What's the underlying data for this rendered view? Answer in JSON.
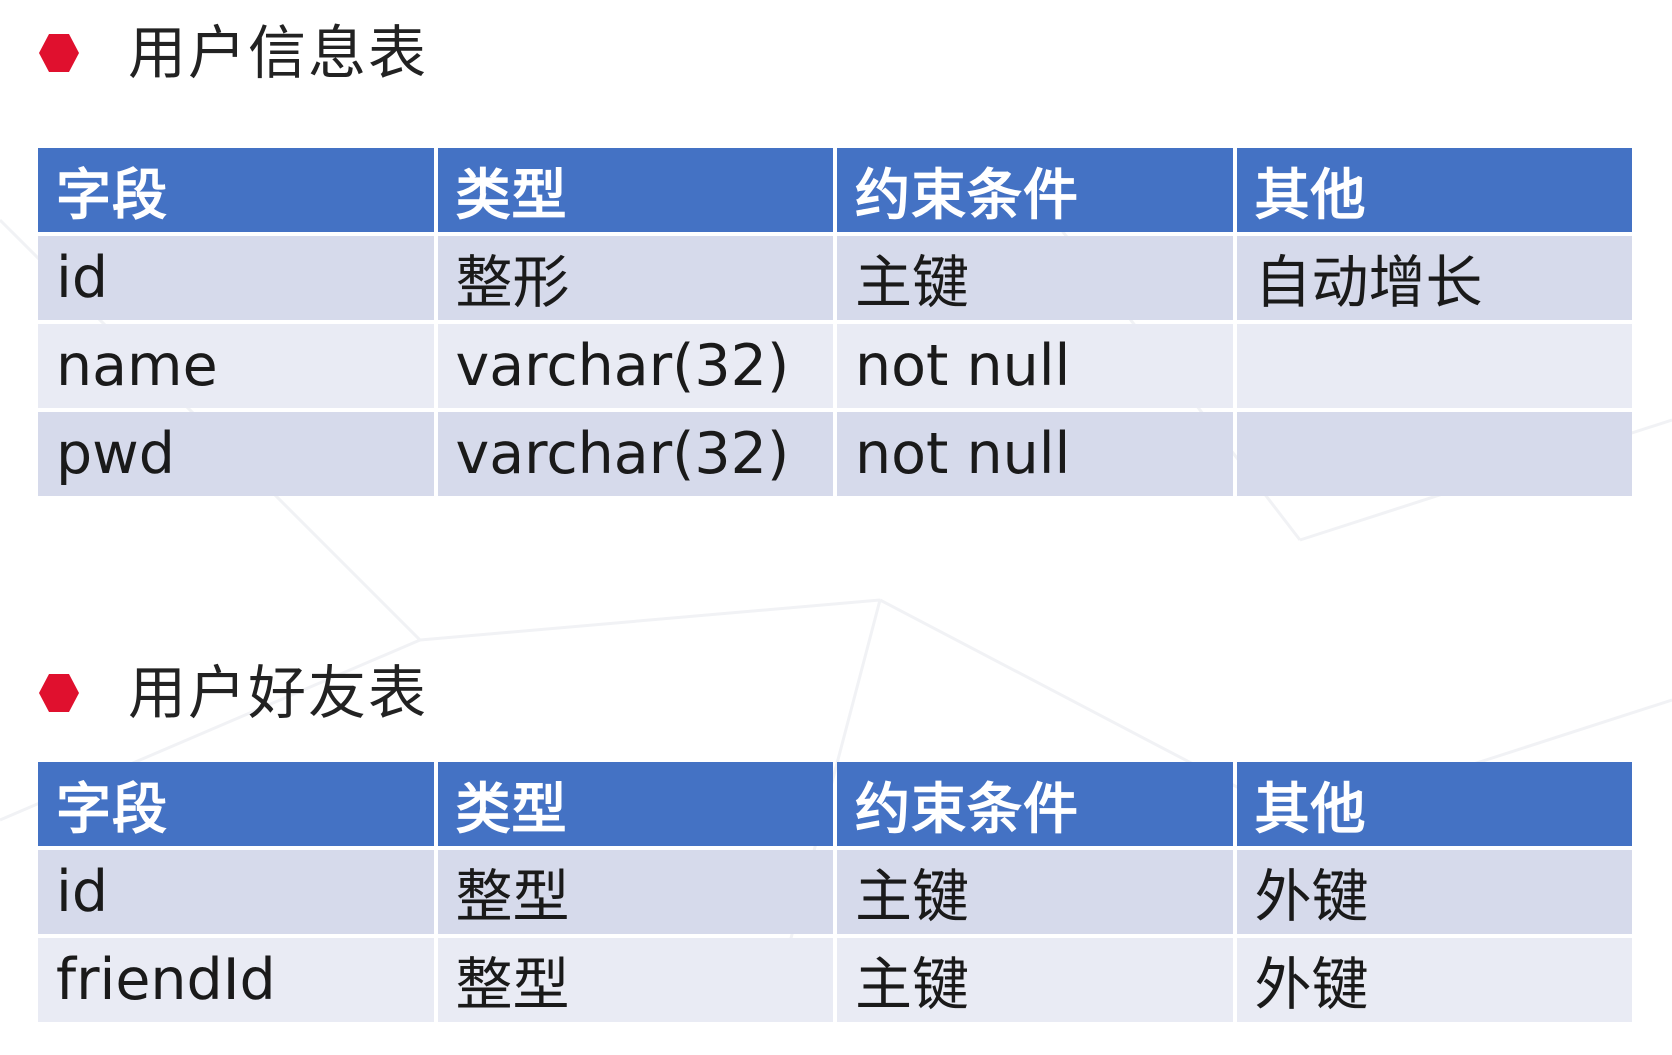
{
  "colors": {
    "bullet": "#e0102e",
    "header_bg": "#4472c4",
    "row_odd": "#d6daeb",
    "row_even": "#e9ebf4"
  },
  "sections": [
    {
      "title": "用户信息表",
      "headers": [
        "字段",
        "类型",
        "约束条件",
        "其他"
      ],
      "rows": [
        [
          "id",
          "整形",
          "主键",
          "自动增长"
        ],
        [
          "name",
          "varchar(32)",
          "not null",
          ""
        ],
        [
          "pwd",
          "varchar(32)",
          "not null",
          ""
        ]
      ]
    },
    {
      "title": "用户好友表",
      "headers": [
        "字段",
        "类型",
        "约束条件",
        "其他"
      ],
      "rows": [
        [
          "id",
          "整型",
          "主键",
          "外键"
        ],
        [
          "friendId",
          "整型",
          "主键",
          "外键"
        ]
      ]
    }
  ]
}
